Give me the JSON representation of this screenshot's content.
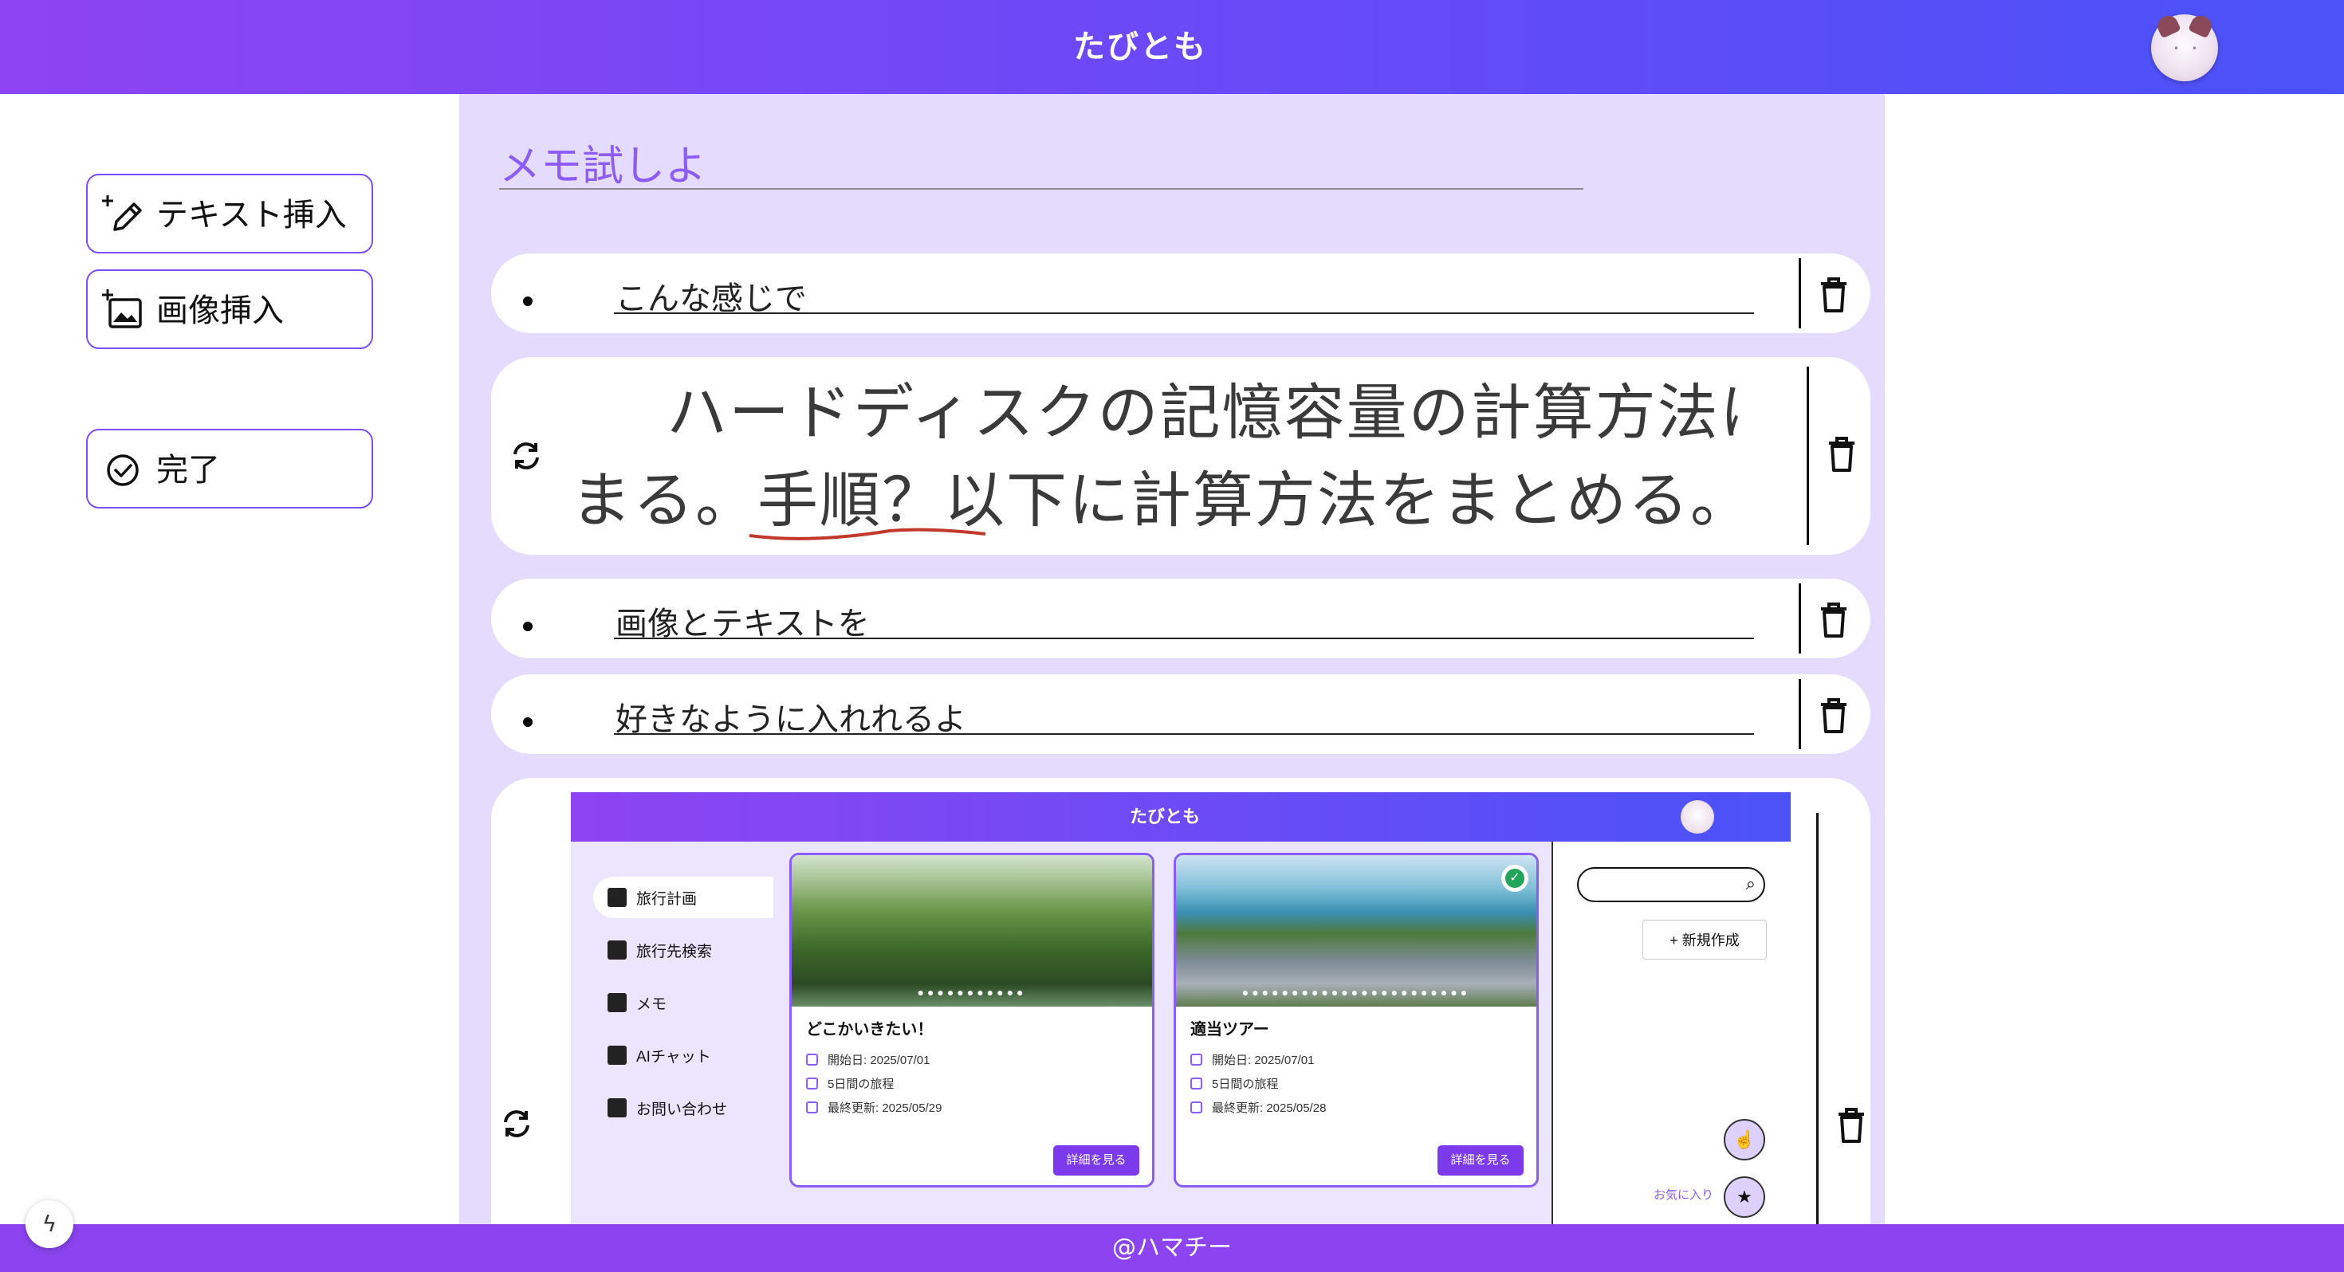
{
  "app": {
    "title": "たびとも"
  },
  "tools": {
    "insert_text": "テキスト挿入",
    "insert_image": "画像挿入",
    "done": "完了"
  },
  "memo": {
    "title": "メモ試しよ",
    "blocks": [
      {
        "type": "text",
        "text": "こんな感じで"
      },
      {
        "type": "image",
        "line1": "ハードディスクの記憶容量の計算方法に",
        "line2": "まる。手順？以下に計算方法をまとめる。"
      },
      {
        "type": "text",
        "text": "画像とテキストを"
      },
      {
        "type": "text",
        "text": "好きなように入れれるよ"
      },
      {
        "type": "image_screenshot"
      }
    ]
  },
  "screenshot": {
    "title": "たびとも",
    "nav": [
      "旅行計画",
      "旅行先検索",
      "メモ",
      "AIチャット",
      "お問い合わせ"
    ],
    "cards": [
      {
        "title": "どこかいきたい！",
        "start": "開始日: 2025/07/01",
        "duration": "5日間の旅程",
        "updated": "最終更新: 2025/05/29",
        "button": "詳細を見る"
      },
      {
        "title": "適当ツアー",
        "start": "開始日: 2025/07/01",
        "duration": "5日間の旅程",
        "updated": "最終更新: 2025/05/28",
        "button": "詳細を見る"
      }
    ],
    "new_button": "+ 新規作成",
    "favorite": "お気に入り"
  },
  "footer": {
    "text": "@ハマチー"
  },
  "icons": {
    "pencil_plus": "pencil-plus-icon",
    "image_plus": "image-plus-icon",
    "check_circle": "check-circle-icon",
    "trash": "trash-icon",
    "refresh": "refresh-icon",
    "lightning": "lightning-icon"
  },
  "colors": {
    "header_start": "#8e44f2",
    "header_end": "#4b52f8",
    "accent": "#7c4dff",
    "editor_bg": "#e5dbfd",
    "title_text": "#8d5cf6"
  }
}
